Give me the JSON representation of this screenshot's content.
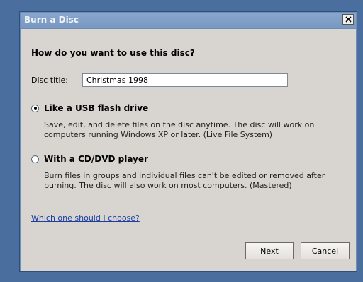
{
  "window": {
    "title": "Burn a Disc"
  },
  "dialog": {
    "question": "How do you want to use this disc?",
    "disc_title_label": "Disc title:",
    "disc_title_value": "Christmas 1998",
    "options": [
      {
        "label": "Like a USB flash drive",
        "description_line1": "Save, edit, and delete files on the disc anytime. The disc will work on",
        "description_line2": "computers running Windows XP or later. (Live File System)",
        "selected": true
      },
      {
        "label": "With a CD/DVD player",
        "description_line1": "Burn files in groups and individual files can't be edited or removed after",
        "description_line2": "burning. The disc will also work on most computers. (Mastered)",
        "selected": false
      }
    ],
    "help_link": "Which one should I choose?",
    "next_label": "Next",
    "cancel_label": "Cancel"
  },
  "icons": {
    "close": "close-icon"
  },
  "colors": {
    "desktop": "#4a6f9f",
    "titlebar": "#7898c2",
    "dialog_bg": "#d8d4cf",
    "link": "#1a3ea3"
  }
}
